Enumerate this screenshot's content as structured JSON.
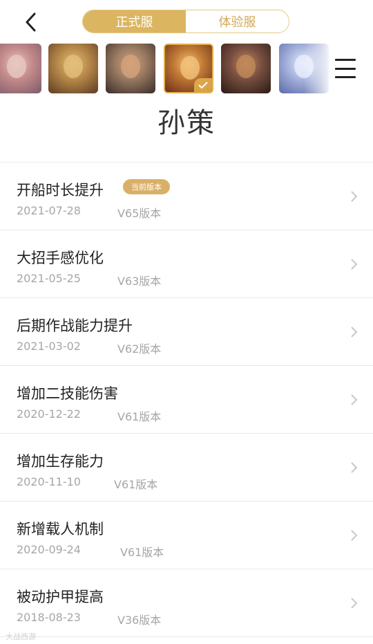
{
  "header": {
    "tabs": [
      {
        "label": "正式服",
        "active": true
      },
      {
        "label": "体验服",
        "active": false
      }
    ],
    "icons": {
      "back": "back-chevron-icon",
      "menu": "hamburger-menu-icon"
    }
  },
  "heroes": [
    {
      "name": "hero-portrait-1",
      "colors": [
        "#c48b8b",
        "#7d5b6a",
        "#e7c8c1"
      ],
      "selected": false
    },
    {
      "name": "hero-portrait-2",
      "colors": [
        "#b88a4a",
        "#5e3b22",
        "#e2bf7a"
      ],
      "selected": false
    },
    {
      "name": "hero-portrait-3",
      "colors": [
        "#9b7b62",
        "#3a2d2a",
        "#d3a27c"
      ],
      "selected": false
    },
    {
      "name": "hero-portrait-4",
      "colors": [
        "#c07a35",
        "#6b2d1b",
        "#f2c27a"
      ],
      "selected": true
    },
    {
      "name": "hero-portrait-5",
      "colors": [
        "#7a5040",
        "#2a1a16",
        "#c28a5a"
      ],
      "selected": false
    },
    {
      "name": "hero-portrait-6",
      "colors": [
        "#aab6de",
        "#5a6aa8",
        "#e9eefc"
      ],
      "selected": false
    }
  ],
  "hero_title": "孙策",
  "updates": [
    {
      "title": "开船时长提升",
      "date": "2021-07-28",
      "version": "V65版本",
      "badge": "当前版本"
    },
    {
      "title": "大招手感优化",
      "date": "2021-05-25",
      "version": "V63版本"
    },
    {
      "title": "后期作战能力提升",
      "date": "2021-03-02",
      "version": "V62版本"
    },
    {
      "title": "增加二技能伤害",
      "date": "2020-12-22",
      "version": "V61版本"
    },
    {
      "title": "增加生存能力",
      "date": "2020-11-10",
      "version": "V61版本"
    },
    {
      "title": "新增载人机制",
      "date": "2020-09-24",
      "version": "V61版本"
    },
    {
      "title": "被动护甲提高",
      "date": "2018-08-23",
      "version": "V36版本"
    }
  ],
  "watermark": "大战西游",
  "colors": {
    "accent": "#dcb560",
    "accent_text": "#d1aa58",
    "muted": "#a6a6a6"
  }
}
